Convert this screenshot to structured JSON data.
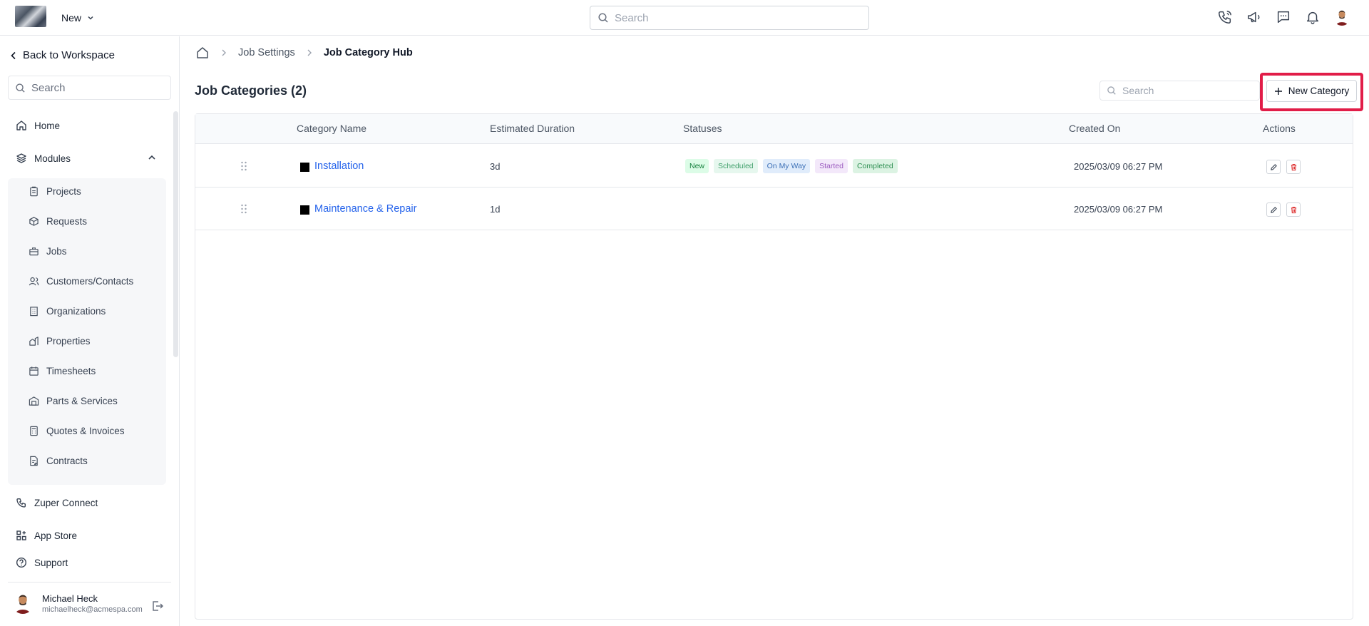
{
  "topbar": {
    "new_label": "New",
    "search_placeholder": "Search"
  },
  "sidebar": {
    "back_label": "Back to Workspace",
    "search_placeholder": "Search",
    "home": "Home",
    "modules": "Modules",
    "module_items": [
      "Projects",
      "Requests",
      "Jobs",
      "Customers/Contacts",
      "Organizations",
      "Properties",
      "Timesheets",
      "Parts & Services",
      "Quotes & Invoices",
      "Contracts"
    ],
    "zuper_connect": "Zuper Connect",
    "app_store": "App Store",
    "support": "Support",
    "user": {
      "name": "Michael Heck",
      "email": "michaelheck@acmespa.com"
    }
  },
  "breadcrumb": {
    "job_settings": "Job Settings",
    "current": "Job Category Hub"
  },
  "main": {
    "title": "Job Categories (2)",
    "search_placeholder": "Search",
    "new_category_label": "New Category"
  },
  "table": {
    "headers": {
      "name": "Category Name",
      "duration": "Estimated Duration",
      "statuses": "Statuses",
      "created": "Created On",
      "actions": "Actions"
    },
    "rows": [
      {
        "name": "Installation",
        "duration": "3d",
        "statuses": [
          "New",
          "Scheduled",
          "On My Way",
          "Started",
          "Completed"
        ],
        "created": "2025/03/09 06:27 PM"
      },
      {
        "name": "Maintenance & Repair",
        "duration": "1d",
        "statuses": [],
        "created": "2025/03/09 06:27 PM"
      }
    ]
  },
  "colors": {
    "link": "#2563eb",
    "highlight": "#e11d48",
    "status_new_bg": "#dcfce7",
    "status_new_fg": "#15803d",
    "status_scheduled_bg": "#e6f7ee",
    "status_scheduled_fg": "#3f9f6a",
    "status_onmyway_bg": "#e0ecfb",
    "status_onmyway_fg": "#3b6fb6",
    "status_started_bg": "#f3e8fa",
    "status_started_fg": "#9b5bbf",
    "status_completed_bg": "#dcf3e3",
    "status_completed_fg": "#2f8f52"
  }
}
